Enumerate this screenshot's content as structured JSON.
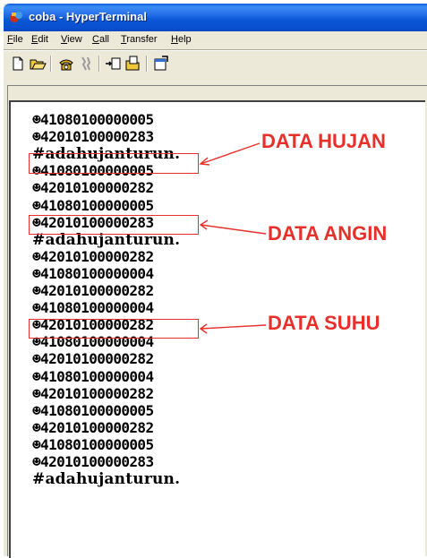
{
  "window": {
    "title": "coba - HyperTerminal"
  },
  "menu": {
    "items": [
      {
        "key": "F",
        "rest": "ile"
      },
      {
        "key": "E",
        "rest": "dit"
      },
      {
        "key": "V",
        "rest": "iew"
      },
      {
        "key": "C",
        "rest": "all"
      },
      {
        "key": "T",
        "rest": "ransfer"
      },
      {
        "key": "H",
        "rest": "elp"
      }
    ]
  },
  "toolbar": {
    "buttons": [
      "new-icon",
      "open-icon",
      "call-icon",
      "disconnect-icon",
      "send-icon",
      "receive-icon",
      "properties-icon"
    ]
  },
  "terminal": {
    "lines": [
      "☻41080100000005",
      "☻42010100000283",
      "#adahujanturun.",
      "☻41080100000005",
      "☻42010100000282",
      "☻41080100000005",
      "☻42010100000283",
      "#adahujanturun.",
      "☻42010100000282",
      "☻41080100000004",
      "☻42010100000282",
      "☻41080100000004",
      "☻42010100000282",
      "☻41080100000004",
      "☻42010100000282",
      "☻41080100000004",
      "☻42010100000282",
      "☻41080100000005",
      "☻42010100000282",
      "☻41080100000005",
      "☻42010100000283",
      "#adahujanturun."
    ]
  },
  "annotations": {
    "hujan": "DATA HUJAN",
    "angin": "DATA ANGIN",
    "suhu": "DATA SUHU",
    "color": "#e8302b"
  }
}
